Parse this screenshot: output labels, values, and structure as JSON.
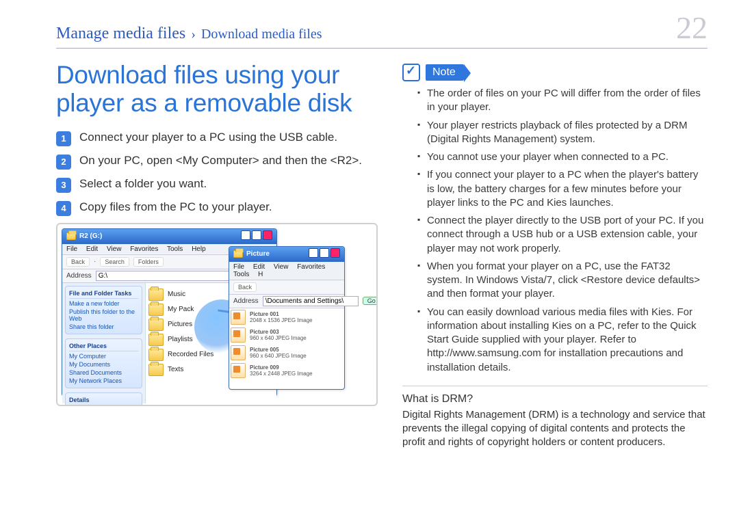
{
  "breadcrumb": {
    "section": "Manage media files",
    "page": "Download media files"
  },
  "page_number": "22",
  "title": "Download files using your player as a removable disk",
  "steps": [
    "Connect your player to a PC using the USB cable.",
    "On your PC, open <My Computer> and then the <R2>.",
    "Select a folder you want.",
    "Copy files from the PC to your player."
  ],
  "screenshot": {
    "win1": {
      "title": "R2 (G:)",
      "menu": [
        "File",
        "Edit",
        "View",
        "Favorites",
        "Tools",
        "Help"
      ],
      "toolbar_back": "Back",
      "toolbar_search": "Search",
      "toolbar_folders": "Folders",
      "address_label": "Address",
      "address_value": "G:\\",
      "side": {
        "tasks_hdr": "File and Folder Tasks",
        "tasks": [
          "Make a new folder",
          "Publish this folder to the Web",
          "Share this folder"
        ],
        "other_hdr": "Other Places",
        "other": [
          "My Computer",
          "My Documents",
          "Shared Documents",
          "My Network Places"
        ],
        "details_hdr": "Details"
      },
      "folders": [
        "Music",
        "My Pack",
        "Pictures",
        "Playlists",
        "Recorded Files",
        "Texts"
      ]
    },
    "win2": {
      "title": "Picture",
      "menu": [
        "File",
        "Edit",
        "View",
        "Favorites",
        "Tools",
        "H"
      ],
      "toolbar_back": "Back",
      "address_label": "Address",
      "address_value": "\\Documents and Settings\\",
      "go": "Go",
      "items": [
        {
          "name": "Picture 001",
          "meta": "2048 x 1536  JPEG Image"
        },
        {
          "name": "Picture 003",
          "meta": "960 x 640  JPEG Image"
        },
        {
          "name": "Picture 005",
          "meta": "960 x 640  JPEG Image"
        },
        {
          "name": "Picture 009",
          "meta": "3264 x 2448  JPEG Image"
        }
      ]
    }
  },
  "note": {
    "label": "Note",
    "items": [
      "The order of files on your PC will differ from the order of files in your player.",
      "Your player restricts playback of files protected by a DRM (Digital Rights Management) system.",
      "You cannot use your player when connected to a PC.",
      "If you connect your player to a PC when the player's battery is low, the battery charges for a few minutes before your player links to the PC and Kies launches.",
      "Connect the player directly to the USB port of your PC. If you connect through a USB hub or a USB extension cable, your player may not work properly.",
      "When you format your player on a PC, use the FAT32 system. In Windows Vista/7, click <Restore device defaults> and then format your player.",
      "You can easily download various media files with Kies. For information about installing Kies on a PC, refer to the Quick Start Guide supplied with your player. Refer to http://www.samsung.com for installation precautions and installation details."
    ]
  },
  "drm": {
    "heading": "What is DRM?",
    "body": "Digital Rights Management (DRM) is a technology and service that prevents the illegal copying of digital contents and protects the profit and rights of copyright holders or content producers."
  }
}
